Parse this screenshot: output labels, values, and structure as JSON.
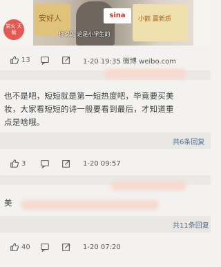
{
  "video": {
    "badge_text": "岩火 天赋",
    "ad_text": "安好人",
    "sina_logo": "sina",
    "subtitle": "你说的 这是小学生的",
    "right_text": "小额 赢新质"
  },
  "post_actions": {
    "like_count": "13",
    "timestamp": "1-20 19:35",
    "source": "微博 weibo.com"
  },
  "comment_1": {
    "lines": [
      "也不是吧，短短就是第一短热度吧，毕竟要买美",
      "妆，大家看短短的诗一般要看到最后，才知道重",
      "点是啥哦。"
    ],
    "reply_label": "共6条回复",
    "like_count": "3",
    "timestamp": "1-20 09:57"
  },
  "comment_2": {
    "lines": [
      "美"
    ],
    "reply_label": "共11条回复",
    "like_count": "40",
    "timestamp": "1-20 07:20"
  },
  "icons": {
    "like": "thumbs-up-icon",
    "comment": "comment-icon",
    "share": "share-icon"
  }
}
